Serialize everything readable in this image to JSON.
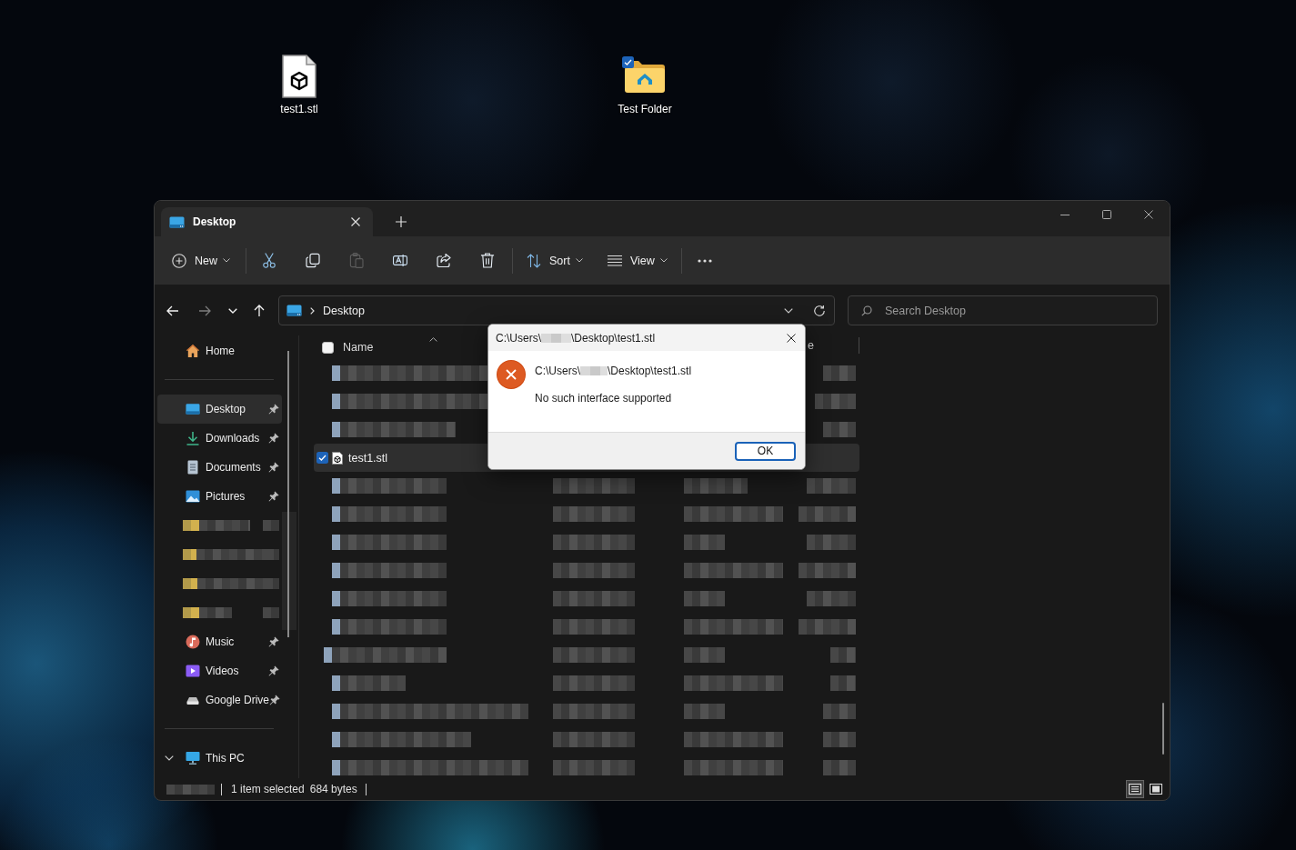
{
  "desktop_icons": [
    {
      "label": "test1.stl",
      "checked": false
    },
    {
      "label": "Test Folder",
      "checked": true
    }
  ],
  "window": {
    "tabs": [
      {
        "title": "Desktop",
        "selected": true
      }
    ],
    "toolbar": {
      "new_button": {
        "label": "New"
      },
      "actions": [
        {
          "disabled": false
        },
        {
          "disabled": false
        },
        {
          "disabled": true
        },
        {
          "disabled": false
        },
        {
          "disabled": false
        },
        {
          "disabled": false
        }
      ],
      "sort_button": {
        "label": "Sort"
      },
      "view_button": {
        "label": "View"
      }
    },
    "navigation": [
      {
        "disabled": false
      },
      {
        "disabled": true
      },
      {
        "disabled": false
      },
      {
        "disabled": false
      }
    ],
    "address": {
      "crumbs": [
        "Desktop"
      ]
    },
    "search": {
      "placeholder": "Search Desktop"
    },
    "sidebar": {
      "home": {
        "label": "Home",
        "selected": false
      },
      "quick_access": [
        {
          "kind": "item",
          "label": "Desktop",
          "pinned": true,
          "selected": true
        },
        {
          "kind": "item",
          "label": "Downloads",
          "pinned": true,
          "selected": false
        },
        {
          "kind": "item",
          "label": "Documents",
          "pinned": true,
          "selected": false
        },
        {
          "kind": "item",
          "label": "Pictures",
          "pinned": true,
          "selected": false
        },
        {
          "kind": "redacted",
          "selected": false
        },
        {
          "kind": "redacted",
          "selected": false
        },
        {
          "kind": "redacted",
          "selected": false
        },
        {
          "kind": "redacted",
          "selected": false
        },
        {
          "kind": "item",
          "label": "Music",
          "pinned": true,
          "selected": false
        },
        {
          "kind": "item",
          "label": "Videos",
          "pinned": true,
          "selected": false
        },
        {
          "kind": "item",
          "label": "Google Drive",
          "pinned": true,
          "selected": false
        }
      ],
      "this_pc": {
        "label": "This PC",
        "expanded": true,
        "selected": false
      }
    },
    "file_list": {
      "select_all_checked": false,
      "name_column": {
        "label": "Name",
        "sorted": true
      },
      "column_4": {
        "label": "e"
      },
      "rows": [
        {
          "kind": "redacted",
          "selected": false
        },
        {
          "kind": "redacted",
          "selected": false
        },
        {
          "kind": "redacted",
          "selected": false
        },
        {
          "kind": "file",
          "name": "test1.stl",
          "selected": true,
          "checked": true
        },
        {
          "kind": "redacted",
          "selected": false
        },
        {
          "kind": "redacted",
          "selected": false
        },
        {
          "kind": "redacted",
          "selected": false
        },
        {
          "kind": "redacted",
          "selected": false
        },
        {
          "kind": "redacted",
          "selected": false
        },
        {
          "kind": "redacted",
          "selected": false
        },
        {
          "kind": "redacted",
          "selected": false
        },
        {
          "kind": "redacted",
          "selected": false
        },
        {
          "kind": "redacted",
          "selected": false
        },
        {
          "kind": "redacted",
          "selected": false
        },
        {
          "kind": "redacted",
          "selected": false
        }
      ]
    },
    "status_bar": {
      "selection": "1 item selected",
      "size": "684 bytes",
      "views": [
        {
          "selected": true
        },
        {
          "selected": false
        }
      ]
    }
  },
  "dialog": {
    "title_start": "C:\\Users\\",
    "title_end": "\\Desktop\\test1.stl",
    "path_start": "C:\\Users\\",
    "path_end": "\\Desktop\\test1.stl",
    "message": "No such interface supported",
    "button": "OK"
  }
}
